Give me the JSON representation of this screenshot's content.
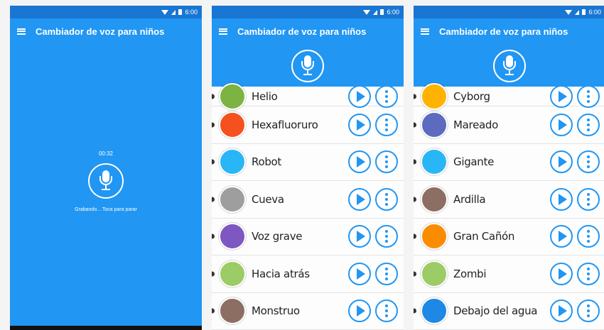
{
  "app": {
    "title": "Cambiador de voz para niños",
    "status_time": "6:00"
  },
  "recording": {
    "timer": "00:32",
    "hint": "Grabando... Toca para parar"
  },
  "list_a": [
    {
      "label": "Helio",
      "icon": "balloon-icon",
      "color": "#7CB342"
    },
    {
      "label": "Hexafluoruro",
      "icon": "flame-icon",
      "color": "#F4511E"
    },
    {
      "label": "Robot",
      "icon": "robot-icon",
      "color": "#29B6F6"
    },
    {
      "label": "Cueva",
      "icon": "cave-icon",
      "color": "#9E9E9E"
    },
    {
      "label": "Voz grave",
      "icon": "monster-face-icon",
      "color": "#7E57C2"
    },
    {
      "label": "Hacia atrás",
      "icon": "rewind-icon",
      "color": "#9CCC65"
    },
    {
      "label": "Monstruo",
      "icon": "monster-icon",
      "color": "#8D6E63"
    }
  ],
  "list_b": [
    {
      "label": "Cyborg",
      "icon": "cyborg-icon",
      "color": "#FFB300"
    },
    {
      "label": "Mareado",
      "icon": "dizzy-icon",
      "color": "#5C6BC0"
    },
    {
      "label": "Gigante",
      "icon": "giant-icon",
      "color": "#29B6F6"
    },
    {
      "label": "Ardilla",
      "icon": "squirrel-icon",
      "color": "#8D6E63"
    },
    {
      "label": "Gran Cañón",
      "icon": "canyon-icon",
      "color": "#FB8C00"
    },
    {
      "label": "Zombi",
      "icon": "zombie-icon",
      "color": "#9CCC65"
    },
    {
      "label": "Debajo del agua",
      "icon": "diver-icon",
      "color": "#1E88E5"
    }
  ]
}
